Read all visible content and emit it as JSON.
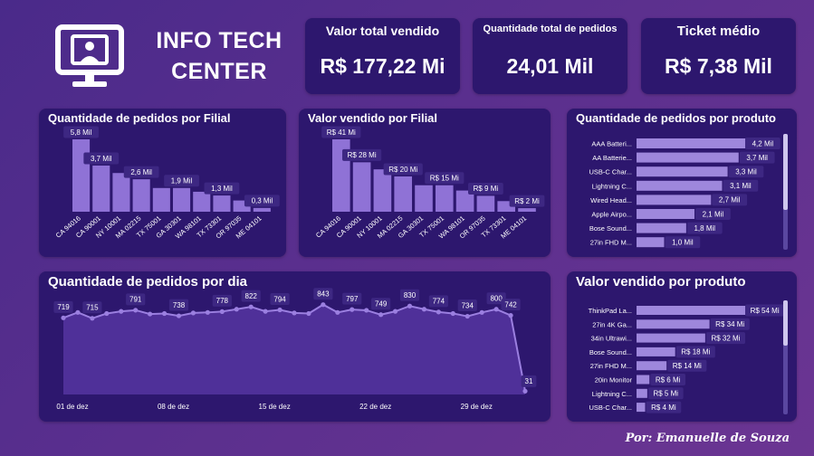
{
  "brand": {
    "title_line1": "INFO TECH",
    "title_line2": "CENTER"
  },
  "kpis": [
    {
      "title": "Valor total vendido",
      "value": "R$ 177,22 Mi"
    },
    {
      "title": "Quantidade total de pedidos",
      "value": "24,01 Mil"
    },
    {
      "title": "Ticket médio",
      "value": "R$ 7,38 Mil"
    }
  ],
  "colors": {
    "bar": "#8f72d6",
    "hbar": "#9e87dc",
    "line": "#9b7fe0",
    "area": "#5b3aa8",
    "label_bg": "#3d2782",
    "panel": "#2d176e"
  },
  "footer": "Por: Emanuelle de Souza",
  "chart_data": [
    {
      "type": "bar",
      "title": "Quantidade de pedidos por Filial",
      "categories": [
        "CA 94016",
        "CA 90001",
        "NY 10001",
        "MA 02215",
        "TX 75001",
        "GA 30301",
        "WA 98101",
        "TX 73301",
        "OR 97035",
        "ME 04101"
      ],
      "values": [
        5.8,
        3.7,
        3.1,
        2.6,
        1.9,
        1.9,
        1.6,
        1.3,
        0.9,
        0.3
      ],
      "data_labels": [
        "5,8 Mil",
        "3,7 Mil",
        "2,6 Mil",
        "1,9 Mil",
        "1,3 Mil",
        "0,3 Mil"
      ],
      "label_indices": [
        0,
        1,
        3,
        5,
        7,
        9
      ],
      "unit": "Mil"
    },
    {
      "type": "bar",
      "title": "Valor vendido por Filial",
      "categories": [
        "CA 94016",
        "CA 90001",
        "NY 10001",
        "MA 02215",
        "GA 30301",
        "TX 75001",
        "WA 98101",
        "OR 97035",
        "TX 73301",
        "ME 04101"
      ],
      "values": [
        41,
        28,
        24,
        20,
        15,
        15,
        12,
        9,
        6,
        2
      ],
      "data_labels": [
        "R$ 41 Mi",
        "R$ 28 Mi",
        "R$ 20 Mi",
        "R$ 15 Mi",
        "R$ 9 Mi",
        "R$ 2 Mi"
      ],
      "label_indices": [
        0,
        1,
        3,
        5,
        7,
        9
      ],
      "unit": "Mi"
    },
    {
      "type": "bar",
      "orientation": "horizontal",
      "title": "Quantidade de pedidos por produto",
      "categories": [
        "AAA Batteri...",
        "AA Batterie...",
        "USB-C Char...",
        "Lightning C...",
        "Wired Head...",
        "Apple Airpo...",
        "Bose Sound...",
        "27in FHD M..."
      ],
      "values": [
        4.2,
        3.7,
        3.3,
        3.1,
        2.7,
        2.1,
        1.8,
        1.0
      ],
      "data_labels": [
        "4,2 Mil",
        "3,7 Mil",
        "3,3 Mil",
        "3,1 Mil",
        "2,7 Mil",
        "2,1 Mil",
        "1,8 Mil",
        "1,0 Mil"
      ]
    },
    {
      "type": "area",
      "title": "Quantidade de pedidos por dia",
      "x": [
        "01 de dez",
        "02 de dez",
        "03 de dez",
        "04 de dez",
        "05 de dez",
        "06 de dez",
        "07 de dez",
        "08 de dez",
        "09 de dez",
        "10 de dez",
        "11 de dez",
        "12 de dez",
        "13 de dez",
        "14 de dez",
        "15 de dez",
        "16 de dez",
        "17 de dez",
        "18 de dez",
        "19 de dez",
        "20 de dez",
        "21 de dez",
        "22 de dez",
        "23 de dez",
        "24 de dez",
        "25 de dez",
        "26 de dez",
        "27 de dez",
        "28 de dez",
        "29 de dez",
        "30 de dez",
        "31 de dez",
        "01 de jan"
      ],
      "values": [
        719,
        770,
        715,
        760,
        780,
        791,
        755,
        760,
        738,
        765,
        770,
        778,
        800,
        822,
        780,
        794,
        765,
        760,
        843,
        770,
        797,
        790,
        749,
        780,
        830,
        800,
        774,
        760,
        734,
        770,
        800,
        742,
        31
      ],
      "x_tick_labels": [
        "01 de dez",
        "08 de dez",
        "15 de dez",
        "22 de dez",
        "29 de dez"
      ],
      "data_labels": [
        "719",
        "715",
        "791",
        "738",
        "778",
        "822",
        "794",
        "843",
        "797",
        "749",
        "830",
        "774",
        "734",
        "800",
        "742",
        "31"
      ],
      "label_indices": [
        0,
        2,
        5,
        8,
        11,
        13,
        15,
        18,
        20,
        22,
        24,
        26,
        28,
        30,
        31,
        32
      ]
    },
    {
      "type": "bar",
      "orientation": "horizontal",
      "title": "Valor vendido por produto",
      "categories": [
        "ThinkPad La...",
        "27in 4K Ga...",
        "34in Ultrawi...",
        "Bose Sound...",
        "27in FHD M...",
        "20in Monitor",
        "Lightning C...",
        "USB-C Char..."
      ],
      "values": [
        54,
        34,
        32,
        18,
        14,
        6,
        5,
        4
      ],
      "data_labels": [
        "R$ 54 Mi",
        "R$ 34 Mi",
        "R$ 32 Mi",
        "R$ 18 Mi",
        "R$ 14 Mi",
        "R$ 6 Mi",
        "R$ 5 Mi",
        "R$ 4 Mi"
      ]
    }
  ]
}
